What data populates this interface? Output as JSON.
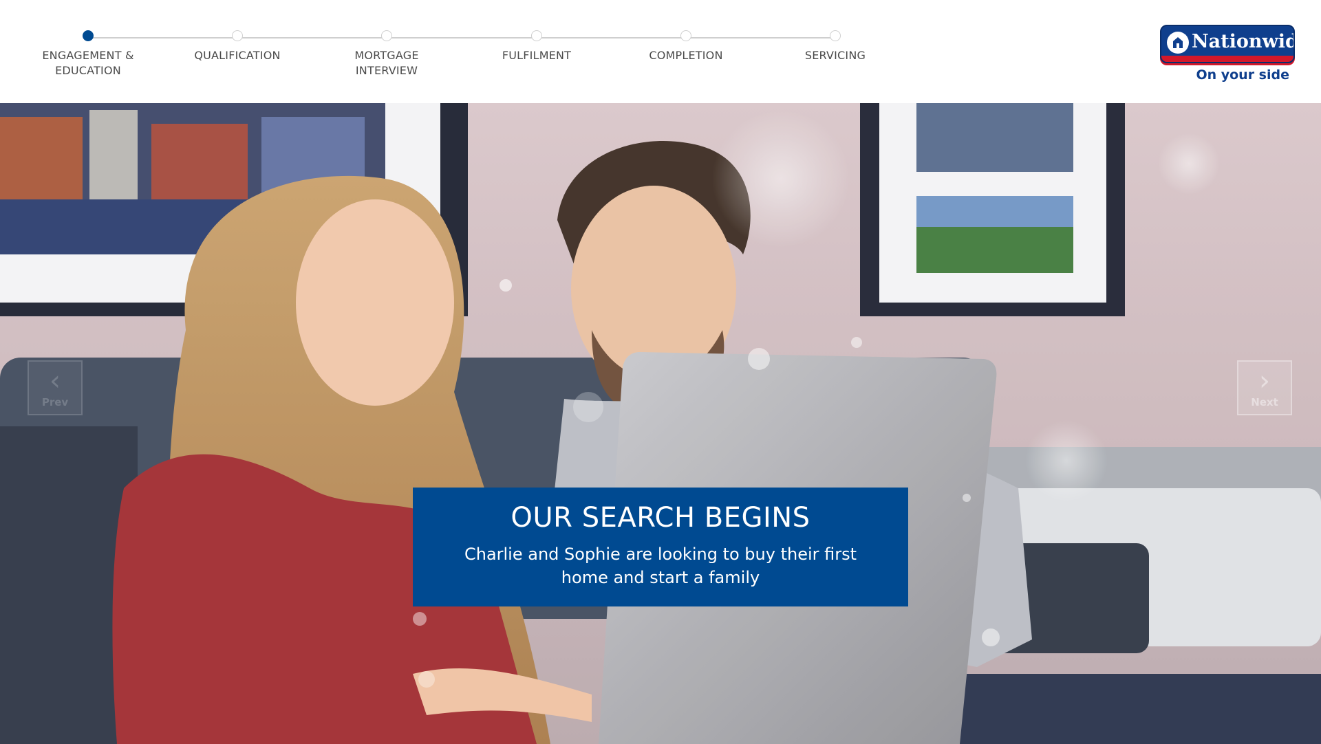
{
  "stepper": {
    "steps": [
      {
        "label": "ENGAGEMENT &\nEDUCATION",
        "active": true
      },
      {
        "label": "QUALIFICATION",
        "active": false
      },
      {
        "label": "MORTGAGE\nINTERVIEW",
        "active": false
      },
      {
        "label": "FULFILMENT",
        "active": false
      },
      {
        "label": "COMPLETION",
        "active": false
      },
      {
        "label": "SERVICING",
        "active": false
      }
    ],
    "active_color": "#004a91",
    "inactive_color": "#cfcfcf"
  },
  "brand": {
    "name": "Nationwide",
    "tagline": "On your side",
    "primary_color": "#0f3f8d",
    "accent_color": "#d3182a",
    "icon": "nationwide-logo-mark"
  },
  "hero": {
    "prev_label": "Prev",
    "next_label": "Next",
    "prev_icon": "chevron-left-icon",
    "next_icon": "chevron-right-icon",
    "caption_title": "OUR SEARCH BEGINS",
    "caption_text": "Charlie and Sophie are looking to buy their first home and start a family",
    "caption_color": "#004a91"
  }
}
